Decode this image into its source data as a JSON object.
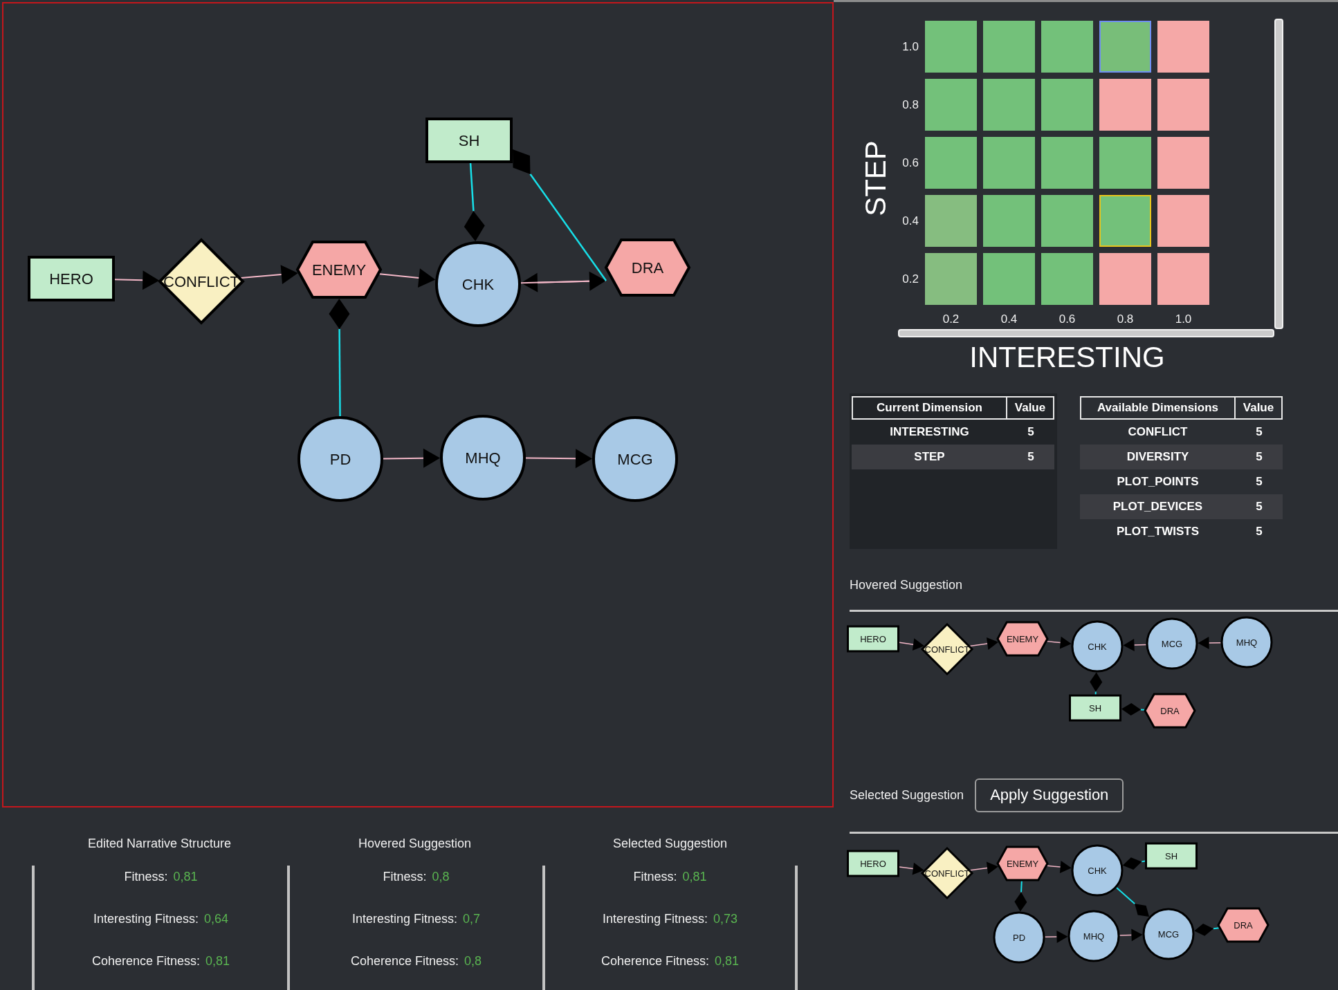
{
  "editor": {
    "graph": {
      "nodes": [
        {
          "label": "HERO",
          "kind": "rectangle"
        },
        {
          "label": "CONFLICT",
          "kind": "diamond"
        },
        {
          "label": "ENEMY",
          "kind": "hexagon"
        },
        {
          "label": "CHK",
          "kind": "circle"
        },
        {
          "label": "DRA",
          "kind": "hexagon"
        },
        {
          "label": "SH",
          "kind": "rectangle"
        },
        {
          "label": "PD",
          "kind": "circle"
        },
        {
          "label": "MHQ",
          "kind": "circle"
        },
        {
          "label": "MCG",
          "kind": "circle"
        }
      ],
      "edges": [
        {
          "kind": "arrow"
        },
        {
          "kind": "arrow"
        },
        {
          "kind": "arrow"
        },
        {
          "kind": "arrow"
        },
        {
          "kind": "arrow"
        },
        {
          "kind": "diamond"
        },
        {
          "kind": "diamond"
        },
        {
          "kind": "diamond"
        },
        {
          "kind": "arrow"
        },
        {
          "kind": "arrow"
        }
      ]
    }
  },
  "map": {
    "ylabel": "STEP",
    "rows": [
      {
        "tick": "1.0",
        "cells": [
          {
            "color": "#73c17a",
            "selected": false,
            "hovered": false
          },
          {
            "color": "#73c17a",
            "selected": false,
            "hovered": false
          },
          {
            "color": "#73c17a",
            "selected": false,
            "hovered": false
          },
          {
            "color": "#78be79",
            "selected": false,
            "hovered": true
          },
          {
            "color": "#f5a8a7",
            "selected": false,
            "hovered": false
          }
        ]
      },
      {
        "tick": "0.8",
        "cells": [
          {
            "color": "#73c17a",
            "selected": false,
            "hovered": false
          },
          {
            "color": "#73c17a",
            "selected": false,
            "hovered": false
          },
          {
            "color": "#73c17a",
            "selected": false,
            "hovered": false
          },
          {
            "color": "#f5a8a7",
            "selected": false,
            "hovered": false
          },
          {
            "color": "#f5a8a7",
            "selected": false,
            "hovered": false
          }
        ]
      },
      {
        "tick": "0.6",
        "cells": [
          {
            "color": "#73c17a",
            "selected": false,
            "hovered": false
          },
          {
            "color": "#73c17a",
            "selected": false,
            "hovered": false
          },
          {
            "color": "#73c17a",
            "selected": false,
            "hovered": false
          },
          {
            "color": "#73c17a",
            "selected": false,
            "hovered": false
          },
          {
            "color": "#f5a8a7",
            "selected": false,
            "hovered": false
          }
        ]
      },
      {
        "tick": "0.4",
        "cells": [
          {
            "color": "#86bd80",
            "selected": false,
            "hovered": false
          },
          {
            "color": "#73c17a",
            "selected": false,
            "hovered": false
          },
          {
            "color": "#73c17a",
            "selected": false,
            "hovered": false
          },
          {
            "color": "#73c17a",
            "selected": true,
            "hovered": false
          },
          {
            "color": "#f5a8a7",
            "selected": false,
            "hovered": false
          }
        ]
      },
      {
        "tick": "0.2",
        "cells": [
          {
            "color": "#86bd80",
            "selected": false,
            "hovered": false
          },
          {
            "color": "#73c17a",
            "selected": false,
            "hovered": false
          },
          {
            "color": "#73c17a",
            "selected": false,
            "hovered": false
          },
          {
            "color": "#f5a8a7",
            "selected": false,
            "hovered": false
          },
          {
            "color": "#f5a8a7",
            "selected": false,
            "hovered": false
          }
        ]
      }
    ],
    "xticks": [
      "0.2",
      "0.4",
      "0.6",
      "0.8",
      "1.0"
    ],
    "xlabel": "INTERESTING"
  },
  "current_dimensions": {
    "columns": [
      "Current Dimension",
      "Value"
    ],
    "rows": [
      {
        "name": "INTERESTING",
        "value": "5"
      },
      {
        "name": "STEP",
        "value": "5"
      }
    ]
  },
  "available_dimensions": {
    "columns": [
      "Available Dimensions",
      "Value"
    ],
    "rows": [
      {
        "name": "CONFLICT",
        "value": "5"
      },
      {
        "name": "DIVERSITY",
        "value": "5"
      },
      {
        "name": "PLOT_POINTS",
        "value": "5"
      },
      {
        "name": "PLOT_DEVICES",
        "value": "5"
      },
      {
        "name": "PLOT_TWISTS",
        "value": "5"
      }
    ]
  },
  "hovered_suggestion": {
    "title": "Hovered Suggestion",
    "graph": {
      "nodes": [
        {
          "label": "HERO",
          "kind": "rectangle"
        },
        {
          "label": "CONFLICT",
          "kind": "diamond"
        },
        {
          "label": "ENEMY",
          "kind": "hexagon"
        },
        {
          "label": "CHK",
          "kind": "circle"
        },
        {
          "label": "MCG",
          "kind": "circle"
        },
        {
          "label": "MHQ",
          "kind": "circle"
        },
        {
          "label": "SH",
          "kind": "rectangle"
        },
        {
          "label": "DRA",
          "kind": "hexagon"
        }
      ],
      "edges": [
        {
          "kind": "arrow"
        },
        {
          "kind": "arrow"
        },
        {
          "kind": "arrow"
        },
        {
          "kind": "arrow"
        },
        {
          "kind": "arrow"
        },
        {
          "kind": "diamond"
        },
        {
          "kind": "diamond"
        }
      ]
    }
  },
  "selected_suggestion": {
    "title": "Selected Suggestion",
    "button": "Apply Suggestion",
    "graph": {
      "nodes": [
        {
          "label": "HERO",
          "kind": "rectangle"
        },
        {
          "label": "CONFLICT",
          "kind": "diamond"
        },
        {
          "label": "ENEMY",
          "kind": "hexagon"
        },
        {
          "label": "CHK",
          "kind": "circle"
        },
        {
          "label": "SH",
          "kind": "rectangle"
        },
        {
          "label": "PD",
          "kind": "circle"
        },
        {
          "label": "MHQ",
          "kind": "circle"
        },
        {
          "label": "MCG",
          "kind": "circle"
        },
        {
          "label": "DRA",
          "kind": "hexagon"
        }
      ],
      "edges": [
        {
          "kind": "arrow"
        },
        {
          "kind": "arrow"
        },
        {
          "kind": "arrow"
        },
        {
          "kind": "diamond"
        },
        {
          "kind": "diamond"
        },
        {
          "kind": "diamond"
        },
        {
          "kind": "arrow"
        },
        {
          "kind": "arrow"
        },
        {
          "kind": "diamond"
        }
      ]
    }
  },
  "fitness_panels": [
    {
      "title": "Edited Narrative Structure",
      "metrics": [
        {
          "label": "Fitness:",
          "value": "0,81"
        },
        {
          "label": "Interesting Fitness:",
          "value": "0,64"
        },
        {
          "label": "Coherence Fitness:",
          "value": "0,81"
        }
      ]
    },
    {
      "title": "Hovered Suggestion",
      "metrics": [
        {
          "label": "Fitness:",
          "value": "0,8"
        },
        {
          "label": "Interesting Fitness:",
          "value": "0,7"
        },
        {
          "label": "Coherence Fitness:",
          "value": "0,8"
        }
      ]
    },
    {
      "title": "Selected Suggestion",
      "metrics": [
        {
          "label": "Fitness:",
          "value": "0,81"
        },
        {
          "label": "Interesting Fitness:",
          "value": "0,73"
        },
        {
          "label": "Coherence Fitness:",
          "value": "0,81"
        }
      ]
    }
  ]
}
